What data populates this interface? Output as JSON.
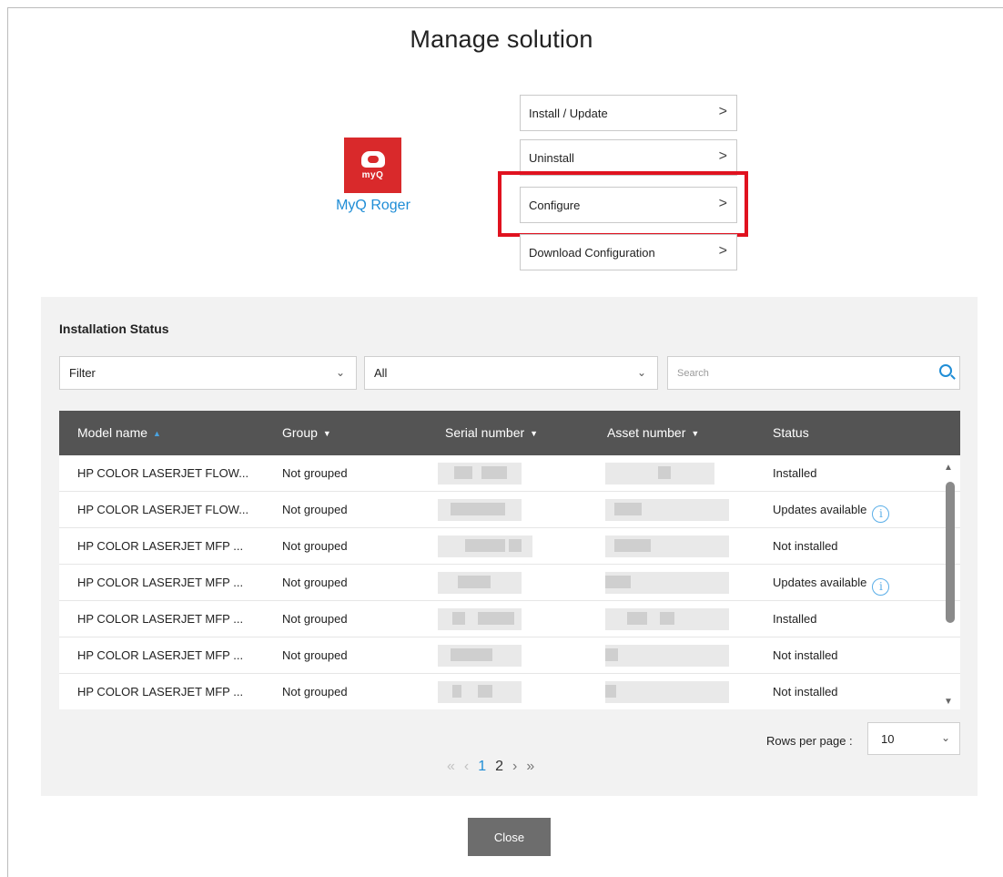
{
  "dialog": {
    "title": "Manage solution",
    "close_label": "Close"
  },
  "app": {
    "name": "MyQ Roger",
    "logo_text": "myQ",
    "logo_color": "#d9292b",
    "icon": "myq-cloud-logo"
  },
  "actions": [
    {
      "label": "Install / Update",
      "icon": "chevron-right-icon"
    },
    {
      "label": "Uninstall",
      "icon": "chevron-right-icon"
    },
    {
      "label": "Configure",
      "icon": "chevron-right-icon",
      "highlighted": true
    },
    {
      "label": "Download Configuration",
      "icon": "chevron-right-icon"
    }
  ],
  "status_panel": {
    "title": "Installation Status",
    "filter": {
      "value": "Filter",
      "icon": "chevron-down-icon"
    },
    "group_filter": {
      "value": "All",
      "icon": "chevron-down-icon"
    },
    "search": {
      "placeholder": "Search",
      "icon": "search-icon"
    },
    "columns": [
      {
        "label": "Model name",
        "sort": "asc-active"
      },
      {
        "label": "Group",
        "sort": "desc"
      },
      {
        "label": "Serial number",
        "sort": "desc"
      },
      {
        "label": "Asset number",
        "sort": "desc"
      },
      {
        "label": "Status",
        "sort": "none"
      }
    ],
    "rows": [
      {
        "model": "HP COLOR LASERJET FLOW...",
        "group": "Not grouped",
        "status": "Installed",
        "info": false
      },
      {
        "model": "HP COLOR LASERJET FLOW...",
        "group": "Not grouped",
        "status": "Updates available",
        "info": true
      },
      {
        "model": "HP COLOR LASERJET MFP ...",
        "group": "Not grouped",
        "status": "Not installed",
        "info": false
      },
      {
        "model": "HP COLOR LASERJET MFP ...",
        "group": "Not grouped",
        "status": "Updates available",
        "info": true
      },
      {
        "model": "HP COLOR LASERJET MFP ...",
        "group": "Not grouped",
        "status": "Installed",
        "info": false
      },
      {
        "model": "HP COLOR LASERJET MFP ...",
        "group": "Not grouped",
        "status": "Not installed",
        "info": false
      },
      {
        "model": "HP COLOR LASERJET MFP ...",
        "group": "Not grouped",
        "status": "Not installed",
        "info": false
      }
    ],
    "rows_per_page": {
      "label": "Rows per page :",
      "value": "10"
    },
    "pagination": {
      "first": "«",
      "prev": "‹",
      "pages": [
        "1",
        "2"
      ],
      "current": "1",
      "next": "›",
      "last": "»"
    }
  },
  "colors": {
    "accent": "#1f8dd6",
    "highlight": "#e0121f",
    "header_bg": "#545454"
  }
}
